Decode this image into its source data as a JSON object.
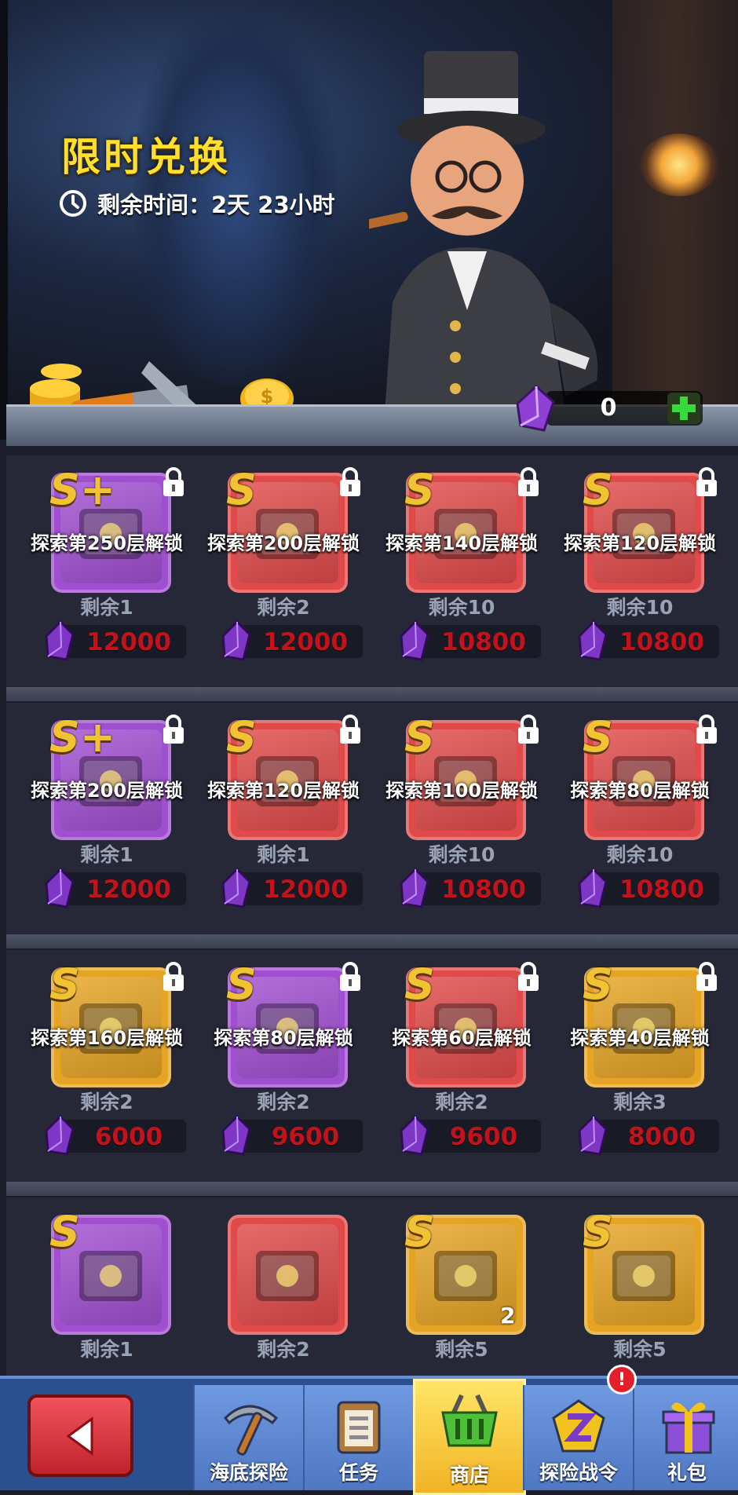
{
  "banner": {
    "title": "限时兑换",
    "timer_text": "剩余时间：2天 23小时"
  },
  "currency": {
    "value": "0",
    "icon": "purple-crystal-icon",
    "add_icon": "plus-icon"
  },
  "shop_rows": [
    [
      {
        "rank": "S+",
        "item": "dark-chest",
        "color": "#a14fd1",
        "lock": "探索第250层解锁",
        "remain": "剩余1",
        "price": "12000"
      },
      {
        "rank": "S",
        "item": "hero-card",
        "color": "#e04a4a",
        "lock": "探索第200层解锁",
        "remain": "剩余2",
        "price": "12000"
      },
      {
        "rank": "S",
        "item": "golden-chest",
        "color": "#e04a4a",
        "lock": "探索第140层解锁",
        "remain": "剩余10",
        "price": "10800"
      },
      {
        "rank": "S",
        "item": "blue-chest",
        "color": "#e04a4a",
        "lock": "探索第120层解锁",
        "remain": "剩余10",
        "price": "10800"
      }
    ],
    [
      {
        "rank": "S+",
        "item": "dark-chest",
        "color": "#a14fd1",
        "lock": "探索第200层解锁",
        "remain": "剩余1",
        "price": "12000"
      },
      {
        "rank": "S",
        "item": "hero-card",
        "color": "#e04a4a",
        "lock": "探索第120层解锁",
        "remain": "剩余1",
        "price": "12000"
      },
      {
        "rank": "S",
        "item": "pink-chest",
        "color": "#e04a4a",
        "lock": "探索第100层解锁",
        "remain": "剩余10",
        "price": "10800"
      },
      {
        "rank": "S",
        "item": "green-chest",
        "color": "#e04a4a",
        "lock": "探索第80层解锁",
        "remain": "剩余10",
        "price": "10800"
      }
    ],
    [
      {
        "rank": "S",
        "item": "hero-card",
        "color": "#e6a424",
        "lock": "探索第160层解锁",
        "remain": "剩余2",
        "price": "6000"
      },
      {
        "rank": "S",
        "item": "purple-badge",
        "color": "#a14fd1",
        "lock": "探索第80层解锁",
        "remain": "剩余2",
        "price": "9600"
      },
      {
        "rank": "S",
        "item": "red-drum",
        "color": "#e04a4a",
        "lock": "探索第60层解锁",
        "remain": "剩余2",
        "price": "9600"
      },
      {
        "rank": "S",
        "item": "tan-chest",
        "color": "#e6a424",
        "lock": "探索第40层解锁",
        "remain": "剩余3",
        "price": "8000"
      }
    ]
  ],
  "bottom_row": [
    {
      "rank": "S",
      "item": "orange-chest",
      "color": "#a14fd1",
      "remain": "剩余1",
      "count": ""
    },
    {
      "rank": "",
      "item": "red-cube",
      "color": "#e04a4a",
      "remain": "剩余2",
      "count": ""
    },
    {
      "rank": "S",
      "item": "gold-chest",
      "color": "#e6a424",
      "remain": "剩余5",
      "count": "2"
    },
    {
      "rank": "S",
      "item": "red-box",
      "color": "#e6a424",
      "remain": "剩余5",
      "count": ""
    }
  ],
  "nav": {
    "back_icon": "back-arrow-icon",
    "tabs": [
      {
        "label": "海底探险",
        "icon": "pickaxe-icon"
      },
      {
        "label": "任务",
        "icon": "clipboard-icon"
      },
      {
        "label": "商店",
        "icon": "basket-icon"
      },
      {
        "label": "探险战令",
        "icon": "z-badge-icon"
      },
      {
        "label": "礼包",
        "icon": "gift-icon"
      }
    ],
    "active_tab": 2,
    "alert_badge": "!"
  }
}
